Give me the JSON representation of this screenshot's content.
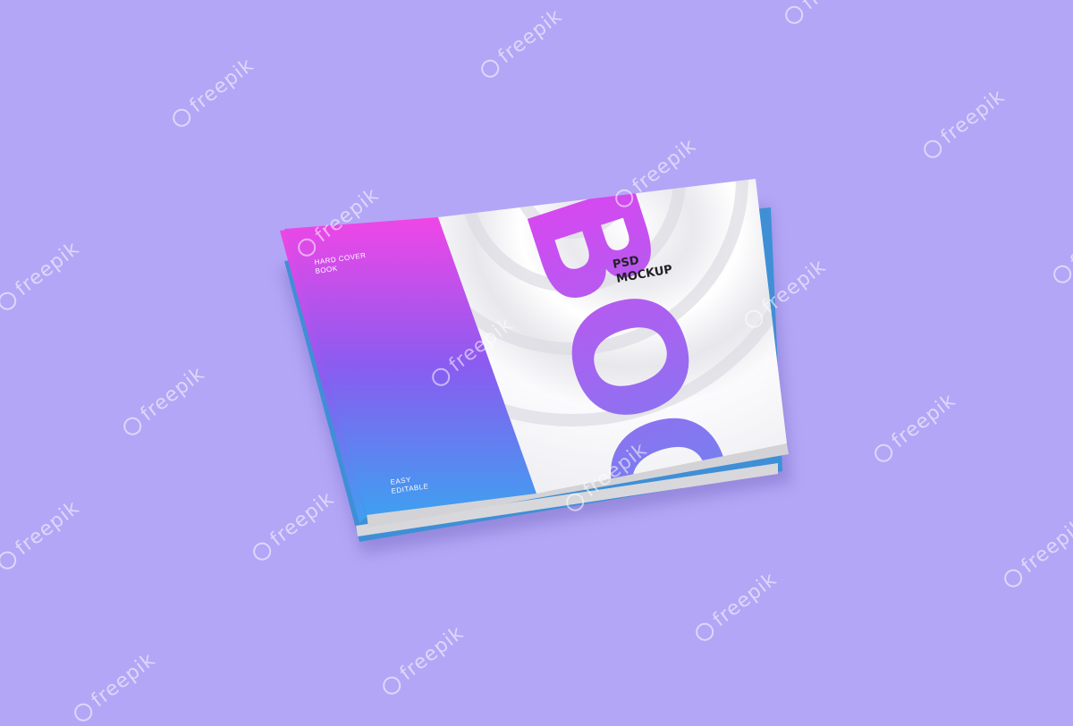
{
  "colors": {
    "background": "#b3a6f6",
    "gradient_top": "#f046e6",
    "gradient_mid": "#8a5cf0",
    "gradient_bottom": "#3f9ff0",
    "cover_white": "#f4f4f6",
    "pages": "#d9d9dc"
  },
  "cover": {
    "hard_cover_line1": "HARD COVER",
    "hard_cover_line2": "BOOK",
    "easy_line1": "EASY",
    "easy_line2": "EDITABLE",
    "title": "BOOK",
    "subtitle_line1": "PSD",
    "subtitle_line2": "MOCKUP"
  },
  "watermark": {
    "text": "freepik",
    "icon": "freepik-logo-icon"
  }
}
